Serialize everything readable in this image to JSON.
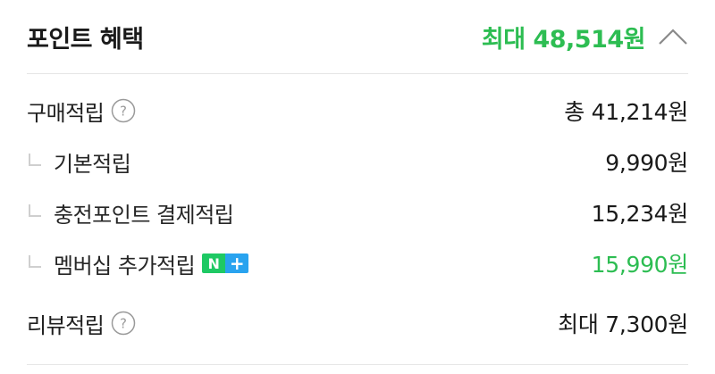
{
  "header": {
    "title": "포인트 혜택",
    "max_amount": "최대 48,514원"
  },
  "rows": [
    {
      "label": "구매적립",
      "value": "총 41,214원",
      "has_help": true
    },
    {
      "label": "기본적립",
      "value": "9,990원"
    },
    {
      "label": "충전포인트 결제적립",
      "value": "15,234원"
    },
    {
      "label": "멤버십 추가적립",
      "value": "15,990원",
      "badge_n": "N",
      "badge_plus": "+"
    },
    {
      "label": "리뷰적립",
      "value": "최대 7,300원",
      "has_help": true
    }
  ],
  "colors": {
    "accent_green": "#2dbd52",
    "badge_green": "#1ec964",
    "badge_blue": "#29a3ef",
    "divider": "#e6e6e6"
  },
  "icons": {
    "collapse": "chevron-up-icon",
    "help": "question-circle-icon",
    "sub_item": "sub-item-mark-icon"
  }
}
